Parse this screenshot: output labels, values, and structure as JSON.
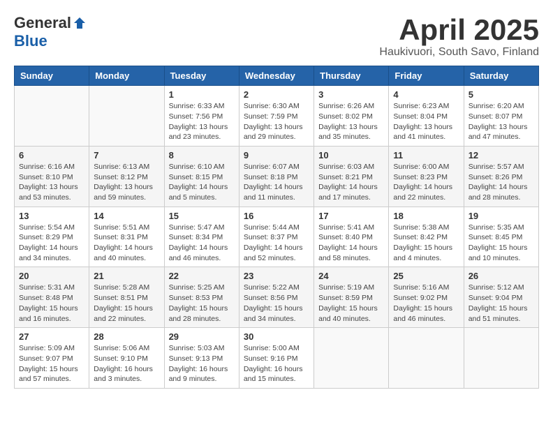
{
  "header": {
    "logo_general": "General",
    "logo_blue": "Blue",
    "month_title": "April 2025",
    "location": "Haukivuori, South Savo, Finland"
  },
  "weekdays": [
    "Sunday",
    "Monday",
    "Tuesday",
    "Wednesday",
    "Thursday",
    "Friday",
    "Saturday"
  ],
  "weeks": [
    [
      {
        "day": "",
        "sunrise": "",
        "sunset": "",
        "daylight": ""
      },
      {
        "day": "",
        "sunrise": "",
        "sunset": "",
        "daylight": ""
      },
      {
        "day": "1",
        "sunrise": "Sunrise: 6:33 AM",
        "sunset": "Sunset: 7:56 PM",
        "daylight": "Daylight: 13 hours and 23 minutes."
      },
      {
        "day": "2",
        "sunrise": "Sunrise: 6:30 AM",
        "sunset": "Sunset: 7:59 PM",
        "daylight": "Daylight: 13 hours and 29 minutes."
      },
      {
        "day": "3",
        "sunrise": "Sunrise: 6:26 AM",
        "sunset": "Sunset: 8:02 PM",
        "daylight": "Daylight: 13 hours and 35 minutes."
      },
      {
        "day": "4",
        "sunrise": "Sunrise: 6:23 AM",
        "sunset": "Sunset: 8:04 PM",
        "daylight": "Daylight: 13 hours and 41 minutes."
      },
      {
        "day": "5",
        "sunrise": "Sunrise: 6:20 AM",
        "sunset": "Sunset: 8:07 PM",
        "daylight": "Daylight: 13 hours and 47 minutes."
      }
    ],
    [
      {
        "day": "6",
        "sunrise": "Sunrise: 6:16 AM",
        "sunset": "Sunset: 8:10 PM",
        "daylight": "Daylight: 13 hours and 53 minutes."
      },
      {
        "day": "7",
        "sunrise": "Sunrise: 6:13 AM",
        "sunset": "Sunset: 8:12 PM",
        "daylight": "Daylight: 13 hours and 59 minutes."
      },
      {
        "day": "8",
        "sunrise": "Sunrise: 6:10 AM",
        "sunset": "Sunset: 8:15 PM",
        "daylight": "Daylight: 14 hours and 5 minutes."
      },
      {
        "day": "9",
        "sunrise": "Sunrise: 6:07 AM",
        "sunset": "Sunset: 8:18 PM",
        "daylight": "Daylight: 14 hours and 11 minutes."
      },
      {
        "day": "10",
        "sunrise": "Sunrise: 6:03 AM",
        "sunset": "Sunset: 8:21 PM",
        "daylight": "Daylight: 14 hours and 17 minutes."
      },
      {
        "day": "11",
        "sunrise": "Sunrise: 6:00 AM",
        "sunset": "Sunset: 8:23 PM",
        "daylight": "Daylight: 14 hours and 22 minutes."
      },
      {
        "day": "12",
        "sunrise": "Sunrise: 5:57 AM",
        "sunset": "Sunset: 8:26 PM",
        "daylight": "Daylight: 14 hours and 28 minutes."
      }
    ],
    [
      {
        "day": "13",
        "sunrise": "Sunrise: 5:54 AM",
        "sunset": "Sunset: 8:29 PM",
        "daylight": "Daylight: 14 hours and 34 minutes."
      },
      {
        "day": "14",
        "sunrise": "Sunrise: 5:51 AM",
        "sunset": "Sunset: 8:31 PM",
        "daylight": "Daylight: 14 hours and 40 minutes."
      },
      {
        "day": "15",
        "sunrise": "Sunrise: 5:47 AM",
        "sunset": "Sunset: 8:34 PM",
        "daylight": "Daylight: 14 hours and 46 minutes."
      },
      {
        "day": "16",
        "sunrise": "Sunrise: 5:44 AM",
        "sunset": "Sunset: 8:37 PM",
        "daylight": "Daylight: 14 hours and 52 minutes."
      },
      {
        "day": "17",
        "sunrise": "Sunrise: 5:41 AM",
        "sunset": "Sunset: 8:40 PM",
        "daylight": "Daylight: 14 hours and 58 minutes."
      },
      {
        "day": "18",
        "sunrise": "Sunrise: 5:38 AM",
        "sunset": "Sunset: 8:42 PM",
        "daylight": "Daylight: 15 hours and 4 minutes."
      },
      {
        "day": "19",
        "sunrise": "Sunrise: 5:35 AM",
        "sunset": "Sunset: 8:45 PM",
        "daylight": "Daylight: 15 hours and 10 minutes."
      }
    ],
    [
      {
        "day": "20",
        "sunrise": "Sunrise: 5:31 AM",
        "sunset": "Sunset: 8:48 PM",
        "daylight": "Daylight: 15 hours and 16 minutes."
      },
      {
        "day": "21",
        "sunrise": "Sunrise: 5:28 AM",
        "sunset": "Sunset: 8:51 PM",
        "daylight": "Daylight: 15 hours and 22 minutes."
      },
      {
        "day": "22",
        "sunrise": "Sunrise: 5:25 AM",
        "sunset": "Sunset: 8:53 PM",
        "daylight": "Daylight: 15 hours and 28 minutes."
      },
      {
        "day": "23",
        "sunrise": "Sunrise: 5:22 AM",
        "sunset": "Sunset: 8:56 PM",
        "daylight": "Daylight: 15 hours and 34 minutes."
      },
      {
        "day": "24",
        "sunrise": "Sunrise: 5:19 AM",
        "sunset": "Sunset: 8:59 PM",
        "daylight": "Daylight: 15 hours and 40 minutes."
      },
      {
        "day": "25",
        "sunrise": "Sunrise: 5:16 AM",
        "sunset": "Sunset: 9:02 PM",
        "daylight": "Daylight: 15 hours and 46 minutes."
      },
      {
        "day": "26",
        "sunrise": "Sunrise: 5:12 AM",
        "sunset": "Sunset: 9:04 PM",
        "daylight": "Daylight: 15 hours and 51 minutes."
      }
    ],
    [
      {
        "day": "27",
        "sunrise": "Sunrise: 5:09 AM",
        "sunset": "Sunset: 9:07 PM",
        "daylight": "Daylight: 15 hours and 57 minutes."
      },
      {
        "day": "28",
        "sunrise": "Sunrise: 5:06 AM",
        "sunset": "Sunset: 9:10 PM",
        "daylight": "Daylight: 16 hours and 3 minutes."
      },
      {
        "day": "29",
        "sunrise": "Sunrise: 5:03 AM",
        "sunset": "Sunset: 9:13 PM",
        "daylight": "Daylight: 16 hours and 9 minutes."
      },
      {
        "day": "30",
        "sunrise": "Sunrise: 5:00 AM",
        "sunset": "Sunset: 9:16 PM",
        "daylight": "Daylight: 16 hours and 15 minutes."
      },
      {
        "day": "",
        "sunrise": "",
        "sunset": "",
        "daylight": ""
      },
      {
        "day": "",
        "sunrise": "",
        "sunset": "",
        "daylight": ""
      },
      {
        "day": "",
        "sunrise": "",
        "sunset": "",
        "daylight": ""
      }
    ]
  ]
}
